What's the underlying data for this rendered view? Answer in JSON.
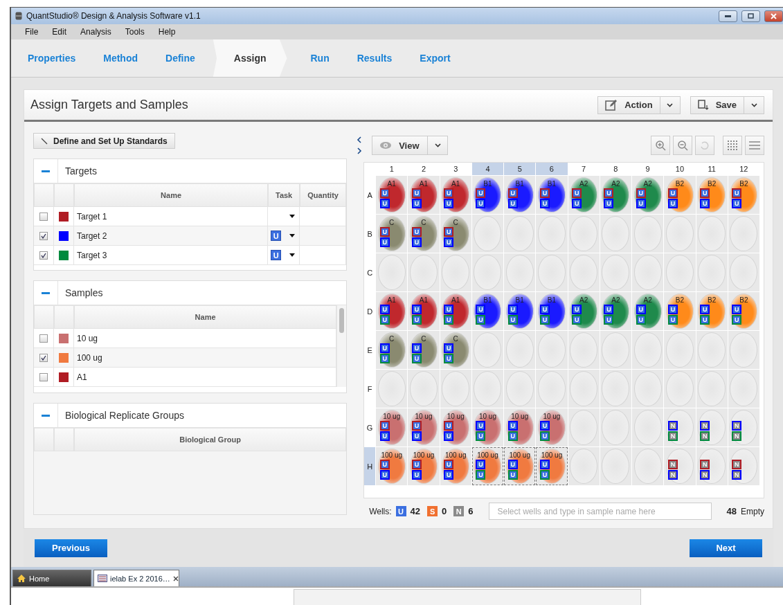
{
  "window": {
    "title": "QuantStudio® Design & Analysis Software v1.1"
  },
  "menu": [
    "File",
    "Edit",
    "Analysis",
    "Tools",
    "Help"
  ],
  "workflow_tabs": [
    {
      "label": "Properties",
      "selected": false
    },
    {
      "label": "Method",
      "selected": false
    },
    {
      "label": "Define",
      "selected": false
    },
    {
      "label": "Assign",
      "selected": true
    },
    {
      "label": "Run",
      "selected": false
    },
    {
      "label": "Results",
      "selected": false
    },
    {
      "label": "Export",
      "selected": false
    }
  ],
  "page_title": "Assign Targets and Samples",
  "toolbar_buttons": [
    {
      "label": "Action",
      "kind": "action"
    },
    {
      "label": "Save",
      "kind": "save"
    }
  ],
  "standards_button": "Define and Set Up Standards",
  "targets": {
    "title": "Targets",
    "expanded": true,
    "columns": [
      "Name",
      "Task",
      "Quantity"
    ],
    "rows": [
      {
        "name": "Target 1",
        "color": "#b01c24",
        "checked": false
      },
      {
        "name": "Target 2",
        "color": "#0000ff",
        "checked": true,
        "task": "U"
      },
      {
        "name": "Target 3",
        "color": "#008a3e",
        "checked": true,
        "task": "U"
      }
    ]
  },
  "samples": {
    "title": "Samples",
    "expanded": true,
    "columns": [
      "Name"
    ],
    "rows": [
      {
        "name": "10 ug",
        "color": "#c97070",
        "checked": false
      },
      {
        "name": "100 ug",
        "color": "#f07a40",
        "checked": true
      },
      {
        "name": "A1",
        "color": "#b01c24",
        "checked": false
      }
    ]
  },
  "bio_groups": {
    "title": "Biological Replicate Groups",
    "expanded": true,
    "columns": [
      "Biological Group"
    ]
  },
  "plate": {
    "view_label": "View",
    "column_headers": [
      {
        "label": "1",
        "selected": false
      },
      {
        "label": "2",
        "selected": false
      },
      {
        "label": "3",
        "selected": false
      },
      {
        "label": "4",
        "selected": true
      },
      {
        "label": "5",
        "selected": true
      },
      {
        "label": "6",
        "selected": true
      },
      {
        "label": "7",
        "selected": false
      },
      {
        "label": "8",
        "selected": false
      },
      {
        "label": "9",
        "selected": false
      },
      {
        "label": "10",
        "selected": false
      },
      {
        "label": "11",
        "selected": false
      },
      {
        "label": "12",
        "selected": false
      }
    ],
    "rows": [
      {
        "label": "A",
        "selected": false,
        "wells": [
          {
            "sample": "A1",
            "color": "#c0282d",
            "tags": [
              {
                "task": "U",
                "color": "#b01c24"
              },
              {
                "task": "U",
                "color": "#0000ff"
              }
            ],
            "selected": false
          },
          {
            "sample": "A1",
            "color": "#c0282d",
            "tags": [
              {
                "task": "U",
                "color": "#b01c24"
              },
              {
                "task": "U",
                "color": "#0000ff"
              }
            ],
            "selected": false
          },
          {
            "sample": "A1",
            "color": "#c0282d",
            "tags": [
              {
                "task": "U",
                "color": "#b01c24"
              },
              {
                "task": "U",
                "color": "#0000ff"
              }
            ],
            "selected": false
          },
          {
            "sample": "B1",
            "color": "#1a1aff",
            "tags": [
              {
                "task": "U",
                "color": "#b01c24"
              },
              {
                "task": "U",
                "color": "#0000ff"
              }
            ],
            "selected": false
          },
          {
            "sample": "B1",
            "color": "#1a1aff",
            "tags": [
              {
                "task": "U",
                "color": "#b01c24"
              },
              {
                "task": "U",
                "color": "#0000ff"
              }
            ],
            "selected": false
          },
          {
            "sample": "B1",
            "color": "#1a1aff",
            "tags": [
              {
                "task": "U",
                "color": "#b01c24"
              },
              {
                "task": "U",
                "color": "#0000ff"
              }
            ],
            "selected": false
          },
          {
            "sample": "A2",
            "color": "#1f8a4c",
            "tags": [
              {
                "task": "U",
                "color": "#b01c24"
              },
              {
                "task": "U",
                "color": "#0000ff"
              }
            ],
            "selected": false
          },
          {
            "sample": "A2",
            "color": "#1f8a4c",
            "tags": [
              {
                "task": "U",
                "color": "#b01c24"
              },
              {
                "task": "U",
                "color": "#0000ff"
              }
            ],
            "selected": false
          },
          {
            "sample": "A2",
            "color": "#1f8a4c",
            "tags": [
              {
                "task": "U",
                "color": "#b01c24"
              },
              {
                "task": "U",
                "color": "#0000ff"
              }
            ],
            "selected": false
          },
          {
            "sample": "B2",
            "color": "#ff8a1a",
            "tags": [
              {
                "task": "U",
                "color": "#b01c24"
              },
              {
                "task": "U",
                "color": "#0000ff"
              }
            ],
            "selected": false
          },
          {
            "sample": "B2",
            "color": "#ff8a1a",
            "tags": [
              {
                "task": "U",
                "color": "#b01c24"
              },
              {
                "task": "U",
                "color": "#0000ff"
              }
            ],
            "selected": false
          },
          {
            "sample": "B2",
            "color": "#ff8a1a",
            "tags": [
              {
                "task": "U",
                "color": "#b01c24"
              },
              {
                "task": "U",
                "color": "#0000ff"
              }
            ],
            "selected": false
          }
        ]
      },
      {
        "label": "B",
        "selected": false,
        "wells": [
          {
            "sample": "C",
            "color": "#8a8a70",
            "tags": [
              {
                "task": "U",
                "color": "#b01c24"
              },
              {
                "task": "U",
                "color": "#0000ff"
              }
            ],
            "selected": false
          },
          {
            "sample": "C",
            "color": "#8a8a70",
            "tags": [
              {
                "task": "U",
                "color": "#b01c24"
              },
              {
                "task": "U",
                "color": "#0000ff"
              }
            ],
            "selected": false
          },
          {
            "sample": "C",
            "color": "#8a8a70",
            "tags": [
              {
                "task": "U",
                "color": "#b01c24"
              },
              {
                "task": "U",
                "color": "#0000ff"
              }
            ],
            "selected": false
          },
          {
            "selected": false
          },
          {
            "selected": false
          },
          {
            "selected": false
          },
          {
            "selected": false
          },
          {
            "selected": false
          },
          {
            "selected": false
          },
          {
            "selected": false
          },
          {
            "selected": false
          },
          {
            "selected": false
          }
        ]
      },
      {
        "label": "C",
        "selected": false,
        "wells": [
          {
            "selected": false
          },
          {
            "selected": false
          },
          {
            "selected": false
          },
          {
            "selected": false
          },
          {
            "selected": false
          },
          {
            "selected": false
          },
          {
            "selected": false
          },
          {
            "selected": false
          },
          {
            "selected": false
          },
          {
            "selected": false
          },
          {
            "selected": false
          },
          {
            "selected": false
          }
        ]
      },
      {
        "label": "D",
        "selected": false,
        "wells": [
          {
            "sample": "A1",
            "color": "#c0282d",
            "tags": [
              {
                "task": "U",
                "color": "#0000ff"
              },
              {
                "task": "U",
                "color": "#008a3e"
              }
            ],
            "selected": false
          },
          {
            "sample": "A1",
            "color": "#c0282d",
            "tags": [
              {
                "task": "U",
                "color": "#0000ff"
              },
              {
                "task": "U",
                "color": "#008a3e"
              }
            ],
            "selected": false
          },
          {
            "sample": "A1",
            "color": "#c0282d",
            "tags": [
              {
                "task": "U",
                "color": "#0000ff"
              },
              {
                "task": "U",
                "color": "#008a3e"
              }
            ],
            "selected": false
          },
          {
            "sample": "B1",
            "color": "#1a1aff",
            "tags": [
              {
                "task": "U",
                "color": "#0000ff"
              },
              {
                "task": "U",
                "color": "#008a3e"
              }
            ],
            "selected": false
          },
          {
            "sample": "B1",
            "color": "#1a1aff",
            "tags": [
              {
                "task": "U",
                "color": "#0000ff"
              },
              {
                "task": "U",
                "color": "#008a3e"
              }
            ],
            "selected": false
          },
          {
            "sample": "B1",
            "color": "#1a1aff",
            "tags": [
              {
                "task": "U",
                "color": "#0000ff"
              },
              {
                "task": "U",
                "color": "#008a3e"
              }
            ],
            "selected": false
          },
          {
            "sample": "A2",
            "color": "#1f8a4c",
            "tags": [
              {
                "task": "U",
                "color": "#0000ff"
              },
              {
                "task": "U",
                "color": "#008a3e"
              }
            ],
            "selected": false
          },
          {
            "sample": "A2",
            "color": "#1f8a4c",
            "tags": [
              {
                "task": "U",
                "color": "#0000ff"
              },
              {
                "task": "U",
                "color": "#008a3e"
              }
            ],
            "selected": false
          },
          {
            "sample": "A2",
            "color": "#1f8a4c",
            "tags": [
              {
                "task": "U",
                "color": "#0000ff"
              },
              {
                "task": "U",
                "color": "#008a3e"
              }
            ],
            "selected": false
          },
          {
            "sample": "B2",
            "color": "#ff8a1a",
            "tags": [
              {
                "task": "U",
                "color": "#0000ff"
              },
              {
                "task": "U",
                "color": "#008a3e"
              }
            ],
            "selected": false
          },
          {
            "sample": "B2",
            "color": "#ff8a1a",
            "tags": [
              {
                "task": "U",
                "color": "#0000ff"
              },
              {
                "task": "U",
                "color": "#008a3e"
              }
            ],
            "selected": false
          },
          {
            "sample": "B2",
            "color": "#ff8a1a",
            "tags": [
              {
                "task": "U",
                "color": "#0000ff"
              },
              {
                "task": "U",
                "color": "#008a3e"
              }
            ],
            "selected": false
          }
        ]
      },
      {
        "label": "E",
        "selected": false,
        "wells": [
          {
            "sample": "C",
            "color": "#8a8a70",
            "tags": [
              {
                "task": "U",
                "color": "#0000ff"
              },
              {
                "task": "U",
                "color": "#008a3e"
              }
            ],
            "selected": false
          },
          {
            "sample": "C",
            "color": "#8a8a70",
            "tags": [
              {
                "task": "U",
                "color": "#0000ff"
              },
              {
                "task": "U",
                "color": "#008a3e"
              }
            ],
            "selected": false
          },
          {
            "sample": "C",
            "color": "#8a8a70",
            "tags": [
              {
                "task": "U",
                "color": "#0000ff"
              },
              {
                "task": "U",
                "color": "#008a3e"
              }
            ],
            "selected": false
          },
          {
            "selected": false
          },
          {
            "selected": false
          },
          {
            "selected": false
          },
          {
            "selected": false
          },
          {
            "selected": false
          },
          {
            "selected": false
          },
          {
            "selected": false
          },
          {
            "selected": false
          },
          {
            "selected": false
          }
        ]
      },
      {
        "label": "F",
        "selected": false,
        "wells": [
          {
            "selected": false
          },
          {
            "selected": false
          },
          {
            "selected": false
          },
          {
            "selected": false
          },
          {
            "selected": false
          },
          {
            "selected": false
          },
          {
            "selected": false
          },
          {
            "selected": false
          },
          {
            "selected": false
          },
          {
            "selected": false
          },
          {
            "selected": false
          },
          {
            "selected": false
          }
        ]
      },
      {
        "label": "G",
        "selected": false,
        "wells": [
          {
            "sample": "10 ug",
            "color": "#c97070",
            "tags": [
              {
                "task": "U",
                "color": "#b01c24"
              },
              {
                "task": "U",
                "color": "#0000ff"
              }
            ],
            "selected": false
          },
          {
            "sample": "10 ug",
            "color": "#c97070",
            "tags": [
              {
                "task": "U",
                "color": "#b01c24"
              },
              {
                "task": "U",
                "color": "#0000ff"
              }
            ],
            "selected": false
          },
          {
            "sample": "10 ug",
            "color": "#c97070",
            "tags": [
              {
                "task": "U",
                "color": "#b01c24"
              },
              {
                "task": "U",
                "color": "#0000ff"
              }
            ],
            "selected": false
          },
          {
            "sample": "10 ug",
            "color": "#c97070",
            "tags": [
              {
                "task": "U",
                "color": "#0000ff"
              },
              {
                "task": "U",
                "color": "#008a3e"
              }
            ],
            "selected": false
          },
          {
            "sample": "10 ug",
            "color": "#c97070",
            "tags": [
              {
                "task": "U",
                "color": "#0000ff"
              },
              {
                "task": "U",
                "color": "#008a3e"
              }
            ],
            "selected": false
          },
          {
            "sample": "10 ug",
            "color": "#c97070",
            "tags": [
              {
                "task": "U",
                "color": "#0000ff"
              },
              {
                "task": "U",
                "color": "#008a3e"
              }
            ],
            "selected": false
          },
          {
            "selected": false
          },
          {
            "selected": false
          },
          {
            "selected": false
          },
          {
            "tags": [
              {
                "task": "N",
                "color": "#0000ff"
              },
              {
                "task": "N",
                "color": "#008a3e"
              }
            ],
            "selected": false
          },
          {
            "tags": [
              {
                "task": "N",
                "color": "#0000ff"
              },
              {
                "task": "N",
                "color": "#008a3e"
              }
            ],
            "selected": false
          },
          {
            "tags": [
              {
                "task": "N",
                "color": "#0000ff"
              },
              {
                "task": "N",
                "color": "#008a3e"
              }
            ],
            "selected": false
          }
        ]
      },
      {
        "label": "H",
        "selected": true,
        "wells": [
          {
            "sample": "100 ug",
            "color": "#f07a40",
            "tags": [
              {
                "task": "U",
                "color": "#b01c24"
              },
              {
                "task": "U",
                "color": "#0000ff"
              }
            ],
            "selected": false
          },
          {
            "sample": "100 ug",
            "color": "#f07a40",
            "tags": [
              {
                "task": "U",
                "color": "#b01c24"
              },
              {
                "task": "U",
                "color": "#0000ff"
              }
            ],
            "selected": false
          },
          {
            "sample": "100 ug",
            "color": "#f07a40",
            "tags": [
              {
                "task": "U",
                "color": "#b01c24"
              },
              {
                "task": "U",
                "color": "#0000ff"
              }
            ],
            "selected": false
          },
          {
            "sample": "100 ug",
            "color": "#f07a40",
            "tags": [
              {
                "task": "U",
                "color": "#0000ff"
              },
              {
                "task": "U",
                "color": "#008a3e"
              }
            ],
            "selected": true
          },
          {
            "sample": "100 ug",
            "color": "#f07a40",
            "tags": [
              {
                "task": "U",
                "color": "#0000ff"
              },
              {
                "task": "U",
                "color": "#008a3e"
              }
            ],
            "selected": true
          },
          {
            "sample": "100 ug",
            "color": "#f07a40",
            "tags": [
              {
                "task": "U",
                "color": "#0000ff"
              },
              {
                "task": "U",
                "color": "#008a3e"
              }
            ],
            "selected": true
          },
          {
            "selected": false
          },
          {
            "selected": false
          },
          {
            "selected": false
          },
          {
            "tags": [
              {
                "task": "N",
                "color": "#b01c24"
              },
              {
                "task": "N",
                "color": "#0000ff"
              }
            ],
            "selected": false
          },
          {
            "tags": [
              {
                "task": "N",
                "color": "#b01c24"
              },
              {
                "task": "N",
                "color": "#0000ff"
              }
            ],
            "selected": false
          },
          {
            "tags": [
              {
                "task": "N",
                "color": "#b01c24"
              },
              {
                "task": "N",
                "color": "#0000ff"
              }
            ],
            "selected": false
          }
        ]
      }
    ],
    "summary": {
      "label": "Wells:",
      "counts": [
        {
          "task": "U",
          "count": "42"
        },
        {
          "task": "S",
          "count": "0"
        },
        {
          "task": "N",
          "count": "6"
        }
      ]
    },
    "sample_field": {
      "placeholder": "Select wells and type in sample name here"
    },
    "empty_count": "48",
    "empty_label": "Empty"
  },
  "nav": {
    "previous": "Previous",
    "next": "Next"
  },
  "bottom_tabs": [
    {
      "label": "Home",
      "kind": "home",
      "selected": false
    },
    {
      "label": "ielab Ex 2 2016…",
      "kind": "document",
      "selected": true
    }
  ]
}
